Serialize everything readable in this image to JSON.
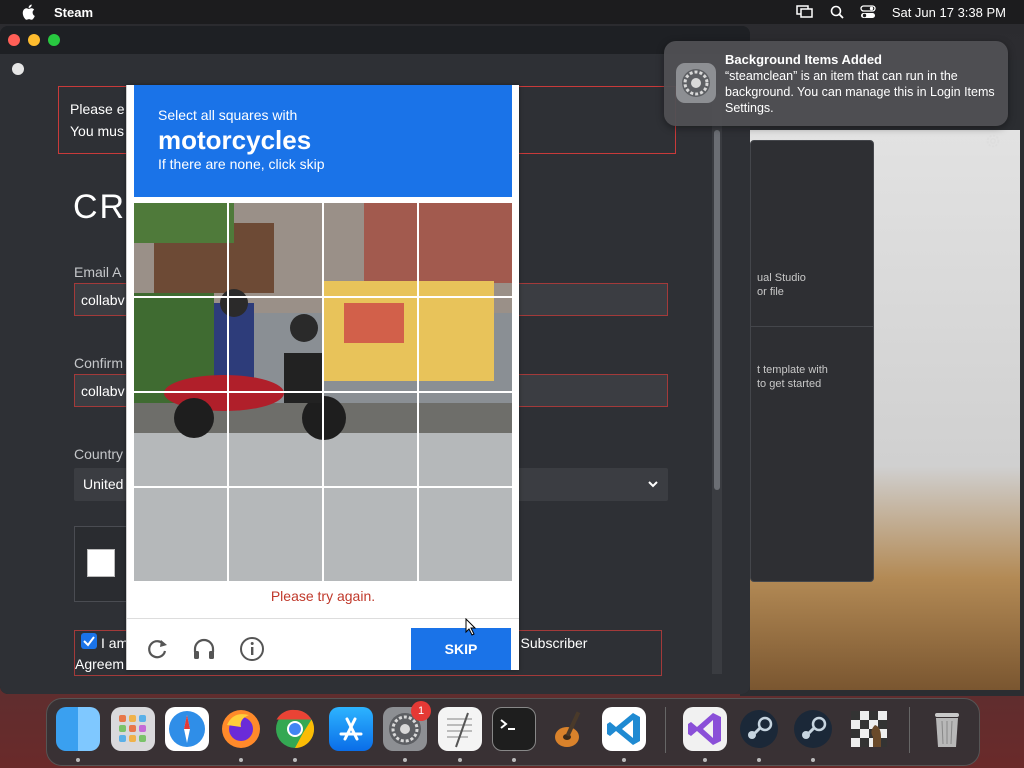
{
  "menubar": {
    "app_name": "Steam",
    "datetime": "Sat Jun 17  3:38 PM"
  },
  "notification": {
    "title": "Background Items Added",
    "body": "“steamclean” is an item that can run in the background. You can manage this in Login Items Settings."
  },
  "steam_form": {
    "error_line1": "Please e",
    "error_line2": "You mus",
    "heading": "CR",
    "email_label": "Email A",
    "email_value": "collabv",
    "confirm_label": "Confirm",
    "confirm_value": "collabv",
    "country_label": "Country",
    "country_value": "United",
    "agree_text": "I am",
    "agree_text2": "Agreem",
    "agree_text3": "m Subscriber"
  },
  "captcha": {
    "instruction": "Select all squares with",
    "target": "motorcycles",
    "hint": "If there are none, click skip",
    "error": "Please try again.",
    "skip_label": "SKIP"
  },
  "bg_window": {
    "line1": "ual Studio",
    "line2": "or file",
    "line3": "t template with",
    "line4": "to get started"
  },
  "dock": {
    "items": [
      "finder-icon",
      "launchpad-icon",
      "safari-icon",
      "firefox-icon",
      "chrome-icon",
      "app-store-icon",
      "system-settings-icon",
      "textedit-icon",
      "terminal-icon",
      "garageband-icon",
      "vscode-icon",
      "visual-studio-icon",
      "steam-icon",
      "steam-icon",
      "chess-icon",
      "trash-icon"
    ],
    "settings_badge": "1"
  },
  "colors": {
    "accent": "#1a73e8",
    "error": "#c0392b"
  }
}
